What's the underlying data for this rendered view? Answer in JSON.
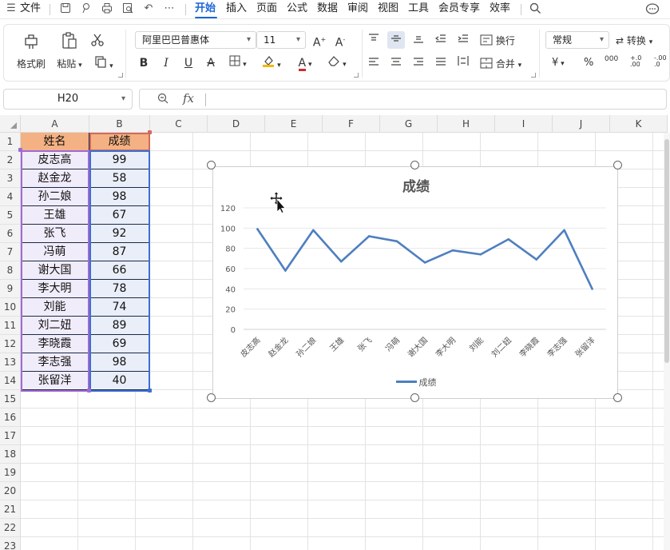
{
  "menu": {
    "file": "文件",
    "tabs": [
      "开始",
      "插入",
      "页面",
      "公式",
      "数据",
      "审阅",
      "视图",
      "工具",
      "会员专享",
      "效率"
    ],
    "active_tab": "开始"
  },
  "ribbon": {
    "format_painter": "格式刷",
    "paste": "粘贴",
    "font_name": "阿里巴巴普惠体",
    "font_size": "11",
    "wrap": "换行",
    "merge": "合并",
    "number_format": "常规",
    "convert": "转换",
    "currency_symbol": "¥",
    "percent_symbol": "%",
    "thousands": "000",
    "inc_decimal": "+.0\n.00",
    "dec_decimal": "-.00\n.0"
  },
  "formula_bar": {
    "name_box": "H20",
    "fx": "fx",
    "content": ""
  },
  "columns": [
    "A",
    "B",
    "C",
    "D",
    "E",
    "F",
    "G",
    "H",
    "I",
    "J",
    "K"
  ],
  "rows": [
    "1",
    "2",
    "3",
    "4",
    "5",
    "6",
    "7",
    "8",
    "9",
    "10",
    "11",
    "12",
    "13",
    "14",
    "15",
    "16",
    "17",
    "18",
    "19",
    "20",
    "21",
    "22",
    "23"
  ],
  "table": {
    "header": [
      "姓名",
      "成绩"
    ],
    "data": [
      [
        "皮志高",
        "99"
      ],
      [
        "赵金龙",
        "58"
      ],
      [
        "孙二娘",
        "98"
      ],
      [
        "王雄",
        "67"
      ],
      [
        "张飞",
        "92"
      ],
      [
        "冯萌",
        "87"
      ],
      [
        "谢大国",
        "66"
      ],
      [
        "李大明",
        "78"
      ],
      [
        "刘能",
        "74"
      ],
      [
        "刘二妞",
        "89"
      ],
      [
        "李晓霞",
        "69"
      ],
      [
        "李志强",
        "98"
      ],
      [
        "张留洋",
        "40"
      ]
    ]
  },
  "chart_data": {
    "type": "line",
    "title": "成绩",
    "categories": [
      "皮志高",
      "赵金龙",
      "孙二娘",
      "王雄",
      "张飞",
      "冯萌",
      "谢大国",
      "李大明",
      "刘能",
      "刘二妞",
      "李晓霞",
      "李志强",
      "张留洋"
    ],
    "series": [
      {
        "name": "成绩",
        "values": [
          99,
          58,
          98,
          67,
          92,
          87,
          66,
          78,
          74,
          89,
          69,
          98,
          40
        ],
        "color": "#4e7fbf"
      }
    ],
    "ylim": [
      0,
      120
    ],
    "yticks": [
      "0",
      "20",
      "40",
      "60",
      "80",
      "100",
      "120"
    ],
    "grid": true,
    "legend": "bottom"
  },
  "colors": {
    "accent": "#1a66d6",
    "header_fill": "#f4b183",
    "col_a_fill": "#f1ecfa",
    "col_b_fill": "#e9eef8"
  }
}
